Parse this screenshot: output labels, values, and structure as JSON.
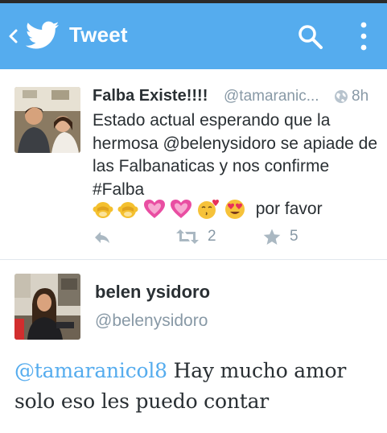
{
  "appbar": {
    "title": "Tweet",
    "background": "#55acee",
    "icons": [
      "back-chevron-icon",
      "twitter-bird-icon",
      "search-icon",
      "overflow-menu-icon"
    ]
  },
  "tweet_1": {
    "name": "Falba Existe!!!!",
    "handle": "@tamaranic...",
    "time": "8h",
    "text": "Estado actual esperando que la hermosa @belenysidoro se apiade de las Falbanaticas y nos confirme #Falba",
    "emoji_icons": [
      "monkey-icon",
      "monkey-icon",
      "pink-heart-icon",
      "pink-heart-icon",
      "kiss-face-icon",
      "heart-eyes-icon"
    ],
    "emoji_text": "por favor",
    "retweet_count": "2",
    "favorite_count": "5"
  },
  "tweet_2": {
    "name": "belen ysidoro",
    "handle": "@belenysidoro",
    "mention": "@tamaranicol8",
    "text": "Hay mucho amor solo eso les puedo contar"
  },
  "colors": {
    "accent": "#55acee",
    "text": "#292f33",
    "muted": "#8899a6",
    "divider": "#e1e8ed"
  }
}
